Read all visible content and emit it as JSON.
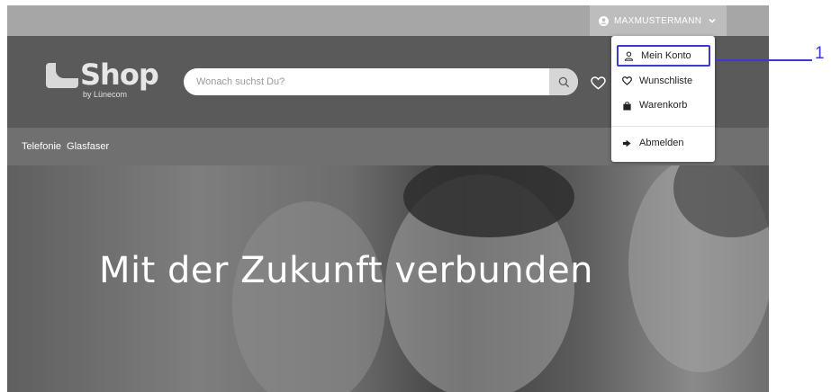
{
  "topbar": {
    "username": "MAXMUSTERMANN"
  },
  "logo": {
    "title": "Shop",
    "subtitle": "by Lünecom"
  },
  "search": {
    "placeholder": "Wonach suchst Du?"
  },
  "nav": {
    "items": [
      "Telefonie",
      "Glasfaser"
    ]
  },
  "hero": {
    "title": "Mit der Zukunft verbunden"
  },
  "dropdown": {
    "items": [
      {
        "label": "Mein Konto",
        "icon": "user-icon"
      },
      {
        "label": "Wunschliste",
        "icon": "heart-icon"
      },
      {
        "label": "Warenkorb",
        "icon": "bag-icon"
      },
      {
        "label": "Abmelden",
        "icon": "logout-icon"
      }
    ]
  },
  "callout": {
    "number": "1"
  },
  "colors": {
    "accent": "#3b3ccc",
    "header": "#5a5a5a",
    "topbar": "#a6a6a6",
    "nav": "#707070"
  }
}
